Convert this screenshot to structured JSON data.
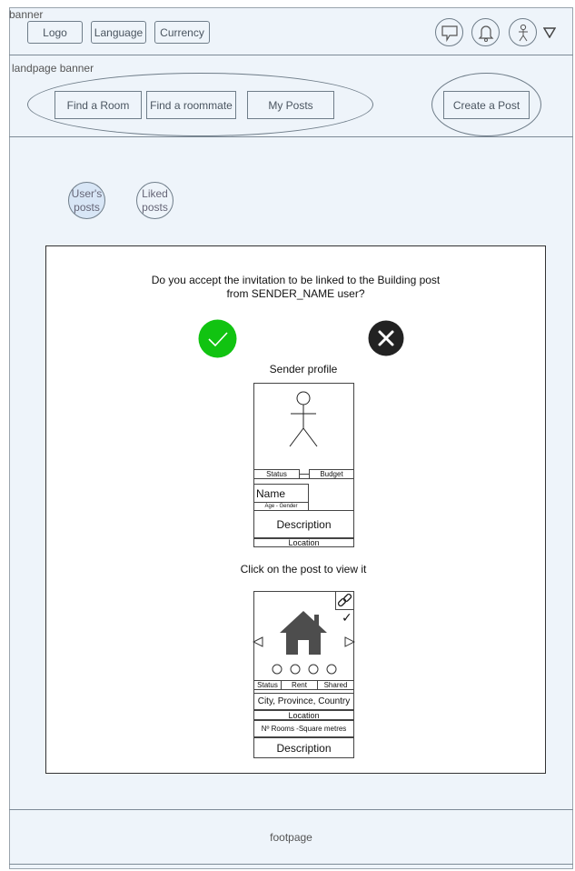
{
  "header": {
    "banner_label": "banner",
    "logo_label": "Logo",
    "language_label": "Language",
    "currency_label": "Currency"
  },
  "landpage": {
    "banner_label": "landpage banner",
    "nav": [
      "Find a Room",
      "Find a roommate",
      "My Posts"
    ],
    "create_post_label": "Create a Post"
  },
  "filters": {
    "users_posts": "User's posts",
    "liked_posts": "Liked posts"
  },
  "modal": {
    "question_line1": "Do you accept the invitation to be linked to the Building post",
    "question_line2": "from SENDER_NAME user?",
    "sender_profile_heading": "Sender profile",
    "profile": {
      "status": "Status",
      "budget": "Budget",
      "name": "Name",
      "age_gender": "Age - Gender",
      "description": "Description",
      "location": "Location"
    },
    "click_post_heading": "Click on the post to view it",
    "post": {
      "status": "Status",
      "rent": "Rent",
      "shared": "Shared",
      "city": "City, Province, Country",
      "location": "Location",
      "rooms": "Nº Rooms -Square metres",
      "description": "Description"
    },
    "accept_color": "#11c311",
    "reject_color": "#222222"
  },
  "footer": {
    "label": "footpage"
  }
}
